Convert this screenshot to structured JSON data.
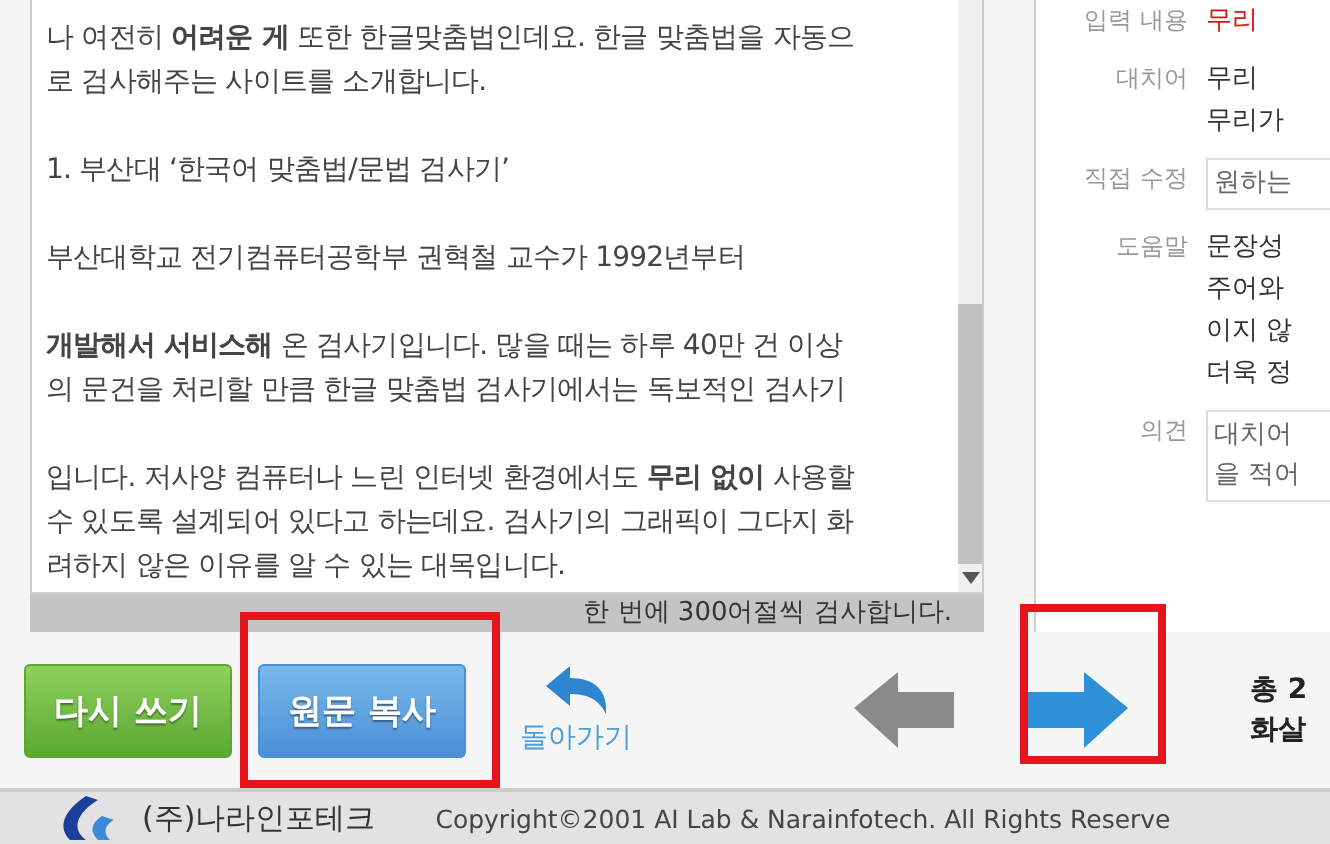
{
  "article": {
    "paragraphs": [
      {
        "lines": [
          "나 여전히 **어려운 게** 또한 한글맞춤법인데요. 한글 맞춤법을 자동으",
          "로 검사해주는 사이트를 소개합니다."
        ]
      },
      {
        "lines": [
          "1. 부산대 ‘한국어 맞춤법/문법 검사기’"
        ]
      },
      {
        "lines": [
          "부산대학교 전기컴퓨터공학부 권혁철 교수가 1992년부터"
        ]
      },
      {
        "lines": [
          "**개발해서 서비스해** 온 검사기입니다. 많을 때는 하루 40만 건 이상",
          "의 문건을 처리할 만큼 한글 맞춤법 검사기에서는 독보적인 검사기"
        ]
      },
      {
        "lines": [
          "입니다. 저사양 컴퓨터나 느린 인터넷 환경에서도 **무리 없이** 사용할",
          "수 있도록 설계되어 있다고 하는데요. 검사기의 그래픽이 그다지 화",
          "려하지 않은 이유를 알 수 있는 대목입니다."
        ]
      }
    ],
    "status": "한 번에 300어절씩 검사합니다."
  },
  "details": [
    {
      "kind": "error",
      "label": "입력 내용",
      "lines": [
        "무리"
      ]
    },
    {
      "kind": "text",
      "label": "대치어",
      "lines": [
        "무리",
        "무리가"
      ]
    },
    {
      "kind": "input",
      "label": "직접 수정",
      "lines": [
        "원하는"
      ]
    },
    {
      "kind": "text",
      "label": "도움말",
      "lines": [
        "문장성",
        "주어와",
        "이지 않",
        "더욱 정"
      ]
    },
    {
      "kind": "textarea",
      "label": "의견",
      "lines": [
        "대치어",
        "을 적어"
      ]
    }
  ],
  "toolbar": {
    "rewrite": "다시 쓰기",
    "copy": "원문 복사",
    "back": "돌아가기",
    "summary": [
      "총 2",
      "화살"
    ]
  },
  "footer": {
    "company": "(주)나라인포테크",
    "copyright": "Copyright©2001 AI Lab & Narainfotech. All Rights Reserve"
  }
}
